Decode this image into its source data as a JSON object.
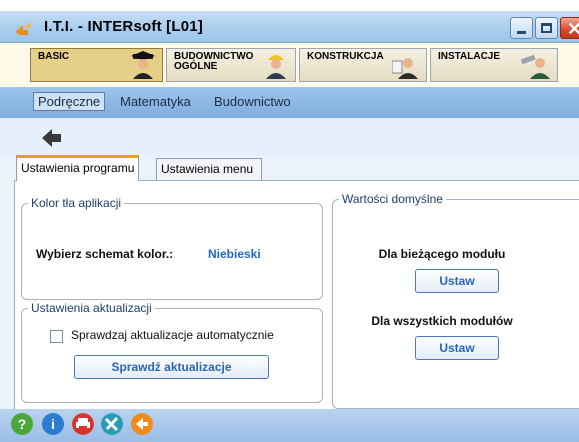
{
  "window": {
    "title": "I.T.I. - INTERsoft [L01]"
  },
  "modules": [
    {
      "label": "BASIC",
      "icon": "graduate-icon"
    },
    {
      "label": "BUDOWNICTWO\nOGÓLNE",
      "icon": "worker-helmet-icon"
    },
    {
      "label": "KONSTRUKCJA",
      "icon": "engineer-icon"
    },
    {
      "label": "INSTALACJE",
      "icon": "plumber-icon"
    }
  ],
  "subnav": [
    "Podręczne",
    "Matematyka",
    "Budownictwo"
  ],
  "tabs": [
    "Ustawienia programu",
    "Ustawienia menu"
  ],
  "background_group": {
    "legend": "Kolor tła aplikacji",
    "label": "Wybierz schemat kolor.:",
    "value": "Niebieski"
  },
  "update_group": {
    "legend": "Ustawienia aktualizacji",
    "checkbox_label": "Sprawdzaj aktualizacje automatycznie",
    "checkbox_checked": false,
    "button": "Sprawdź aktualizacje"
  },
  "defaults_group": {
    "legend": "Wartości domyślne",
    "current_label": "Dla bieżącego modułu",
    "current_button": "Ustaw",
    "all_label": "Dla wszystkich modułów",
    "all_button": "Ustaw"
  },
  "bottom_icons": [
    "help-icon",
    "info-icon",
    "print-icon",
    "tools-icon",
    "exit-icon"
  ],
  "colors": {
    "accent_tab": "#e6a21f",
    "value_blue": "#1f68c7"
  }
}
